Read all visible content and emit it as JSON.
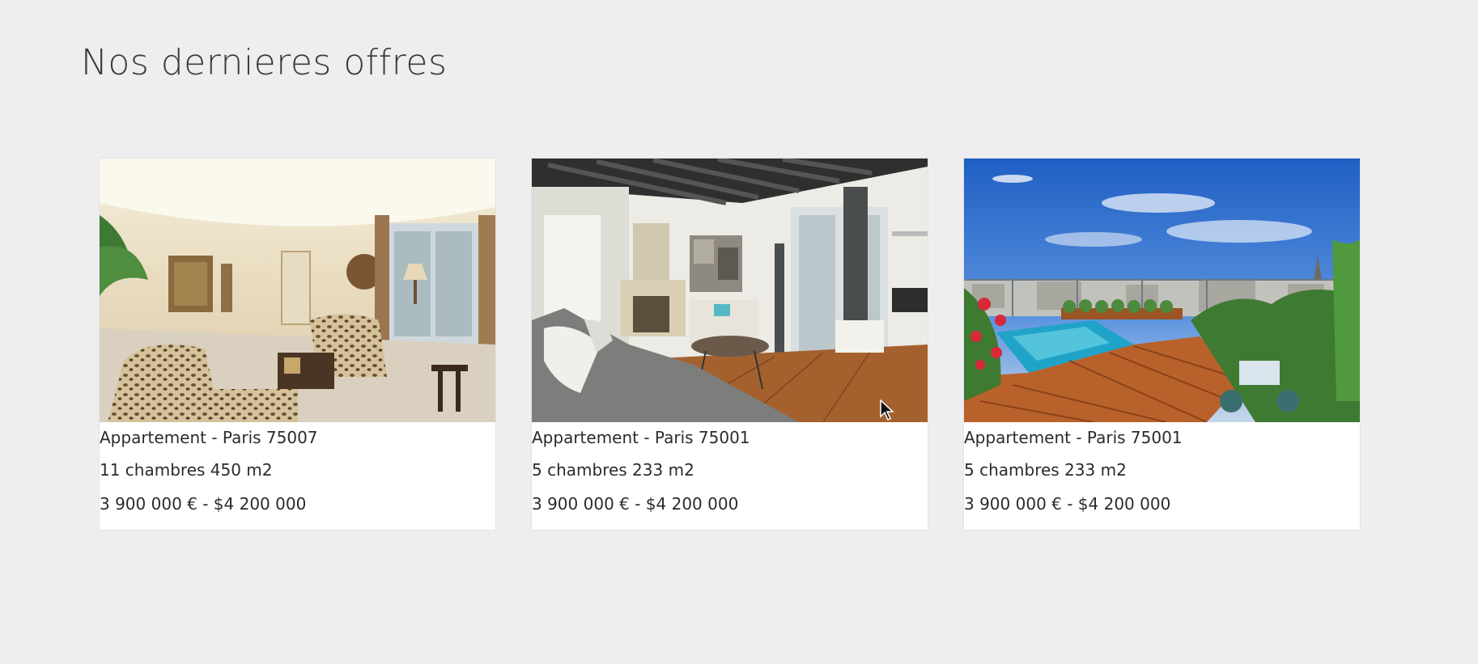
{
  "page": {
    "title": "Nos dernieres offres"
  },
  "listings": [
    {
      "type_location": "Appartement - Paris 75007",
      "rooms_area": "11 chambres 450 m2",
      "price": "3 900 000 € - $4 200 000",
      "image": "living-room-leopard-sofas-photo"
    },
    {
      "type_location": "Appartement - Paris 75001",
      "rooms_area": "5 chambres 233 m2",
      "price": "3 900 000 € - $4 200 000",
      "image": "living-room-grey-sofa-photo"
    },
    {
      "type_location": "Appartement - Paris 75001",
      "rooms_area": "5 chambres 233 m2",
      "price": "3 900 000 € - $4 200 000",
      "image": "rooftop-terrace-pool-photo"
    }
  ],
  "colors": {
    "background": "#eeedf0",
    "card": "#ffffff",
    "text": "#2b2b2b"
  }
}
